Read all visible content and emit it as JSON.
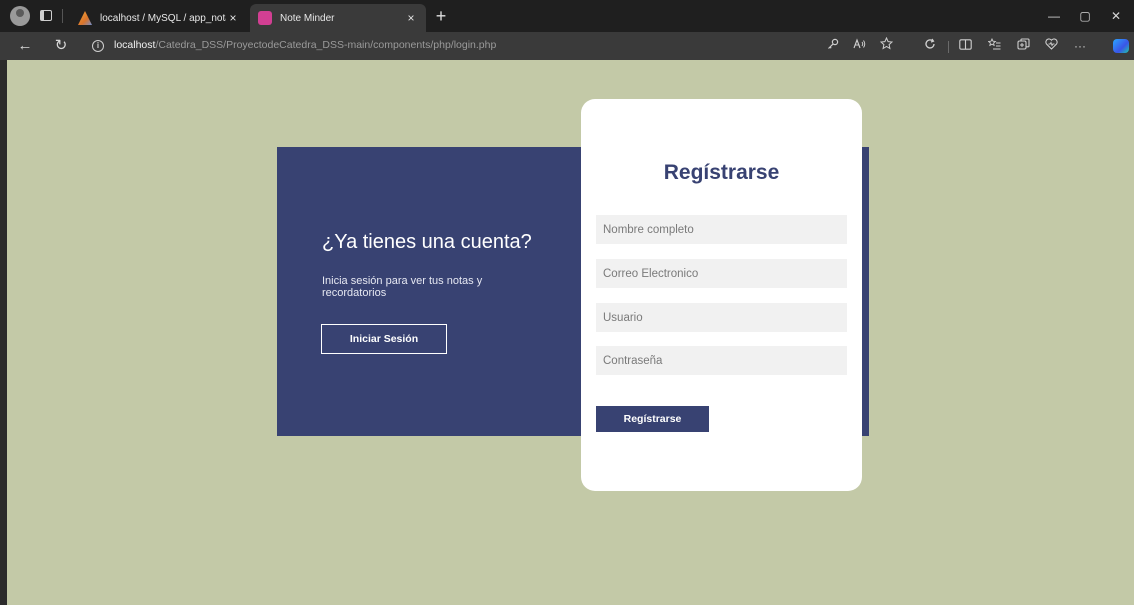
{
  "browser": {
    "tabs": [
      {
        "title": "localhost / MySQL / app_notas /",
        "icon": "phpmyadmin-icon",
        "close": "×"
      },
      {
        "title": "Note Minder",
        "icon": "note-minder-icon",
        "close": "×"
      }
    ],
    "new_tab": "+",
    "url_host": "localhost",
    "url_path": "/Catedra_DSS/ProyectodeCatedra_DSS-main/components/php/login.php",
    "window_controls": {
      "minimize": "—",
      "maximize": "▢",
      "close": "✕"
    },
    "nav": {
      "back": "←",
      "refresh": "↻",
      "more": "···"
    }
  },
  "login_panel": {
    "title": "¿Ya tienes una cuenta?",
    "text": "Inicia sesión para ver tus notas y recordatorios",
    "button": "Iniciar Sesión"
  },
  "register_form": {
    "title": "Regístrarse",
    "fields": [
      {
        "placeholder": "Nombre completo"
      },
      {
        "placeholder": "Correo Electronico"
      },
      {
        "placeholder": "Usuario"
      },
      {
        "placeholder": "Contraseña"
      }
    ],
    "button": "Regístrarse"
  },
  "colors": {
    "background": "#c3c9a7",
    "panel": "#384272",
    "card": "#ffffff",
    "field": "#f1f1f1"
  }
}
